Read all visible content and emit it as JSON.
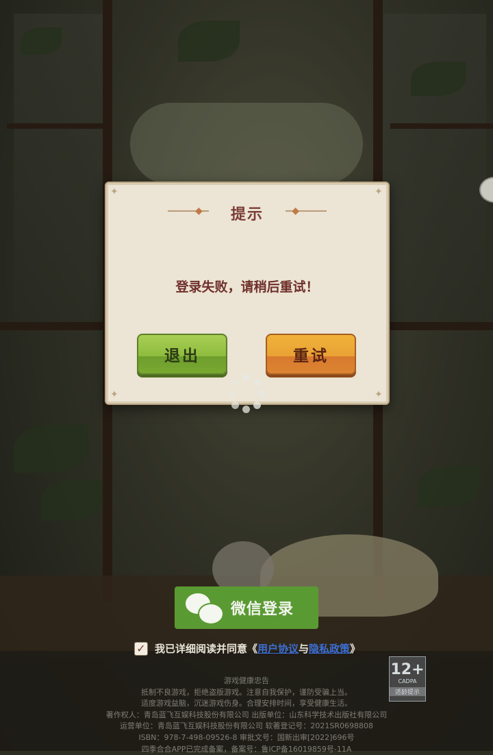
{
  "dialog": {
    "title": "提示",
    "message": "登录失败，请稍后重试！",
    "exit_label": "退出",
    "retry_label": "重试"
  },
  "login": {
    "wechat_label": "微信登录",
    "agreement_prefix": "我已详细阅读并同意《",
    "user_agreement": "用户协议",
    "connector": "与",
    "privacy_policy": "隐私政策",
    "agreement_suffix": "》",
    "checked": true
  },
  "age_rating": {
    "number": "12+",
    "org": "CADPA",
    "tip": "适龄提示"
  },
  "legal": {
    "heading": "游戏健康忠告",
    "line1": "抵制不良游戏，拒绝盗版游戏。注意自我保护，谨防受骗上当。",
    "line2": "适度游戏益脑，沉迷游戏伤身。合理安排时间，享受健康生活。",
    "line3": "著作权人：青岛蓝飞互娱科技股份有限公司 出版单位：山东科学技术出版社有限公司",
    "line4": "运营单位：青岛蓝飞互娱科技股份有限公司 软著登记号：2021SR0698808",
    "line5": "ISBN：978-7-498-09526-8 审批文号：国新出审[2022]696号",
    "line6": "四季合合APP已完成备案，备案号：鲁ICP备16019859号-11A"
  }
}
